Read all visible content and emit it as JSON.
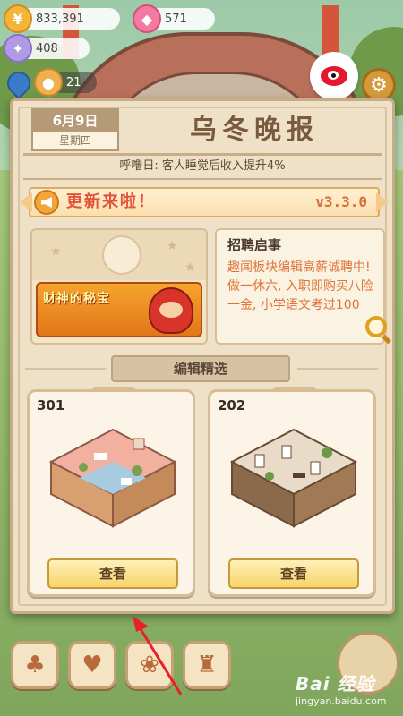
{
  "hud": {
    "gold": "833,391",
    "gems": "571",
    "crystal": "408",
    "level": "21"
  },
  "paper": {
    "date": "6月9日",
    "weekday": "星期四",
    "title": "乌冬晚报",
    "headline": "呼噜日: 客人睡觉后收入提升4%"
  },
  "update": {
    "label": "更新来啦！",
    "version": "v3.3.0"
  },
  "ad": {
    "title": "财神的秘宝"
  },
  "notice": {
    "title": "招聘启事",
    "body": "趣闻板块编辑高薪诚聘中! 做一休六, 入职即购买八险一金, 小学语文考过100"
  },
  "editors_pick": {
    "header": "编辑精选",
    "rooms": [
      {
        "number": "301",
        "button": "查看"
      },
      {
        "number": "202",
        "button": "查看"
      }
    ]
  },
  "watermark": {
    "main": "Bai 经验",
    "sub": "jingyan.baidu.com"
  },
  "colors": {
    "panel_bg": "#efe1c8",
    "accent_red": "#e2543a",
    "version_orange": "#d86c3a",
    "button_yellow": "#f8d46a",
    "annotation_red": "#e8202a"
  },
  "icons": {
    "gold": "coin-icon",
    "gems": "gem-icon",
    "crystal": "crystal-icon",
    "share": "weibo-icon",
    "settings": "gear-icon",
    "update": "megaphone-icon",
    "notice": "magnifier-icon"
  }
}
